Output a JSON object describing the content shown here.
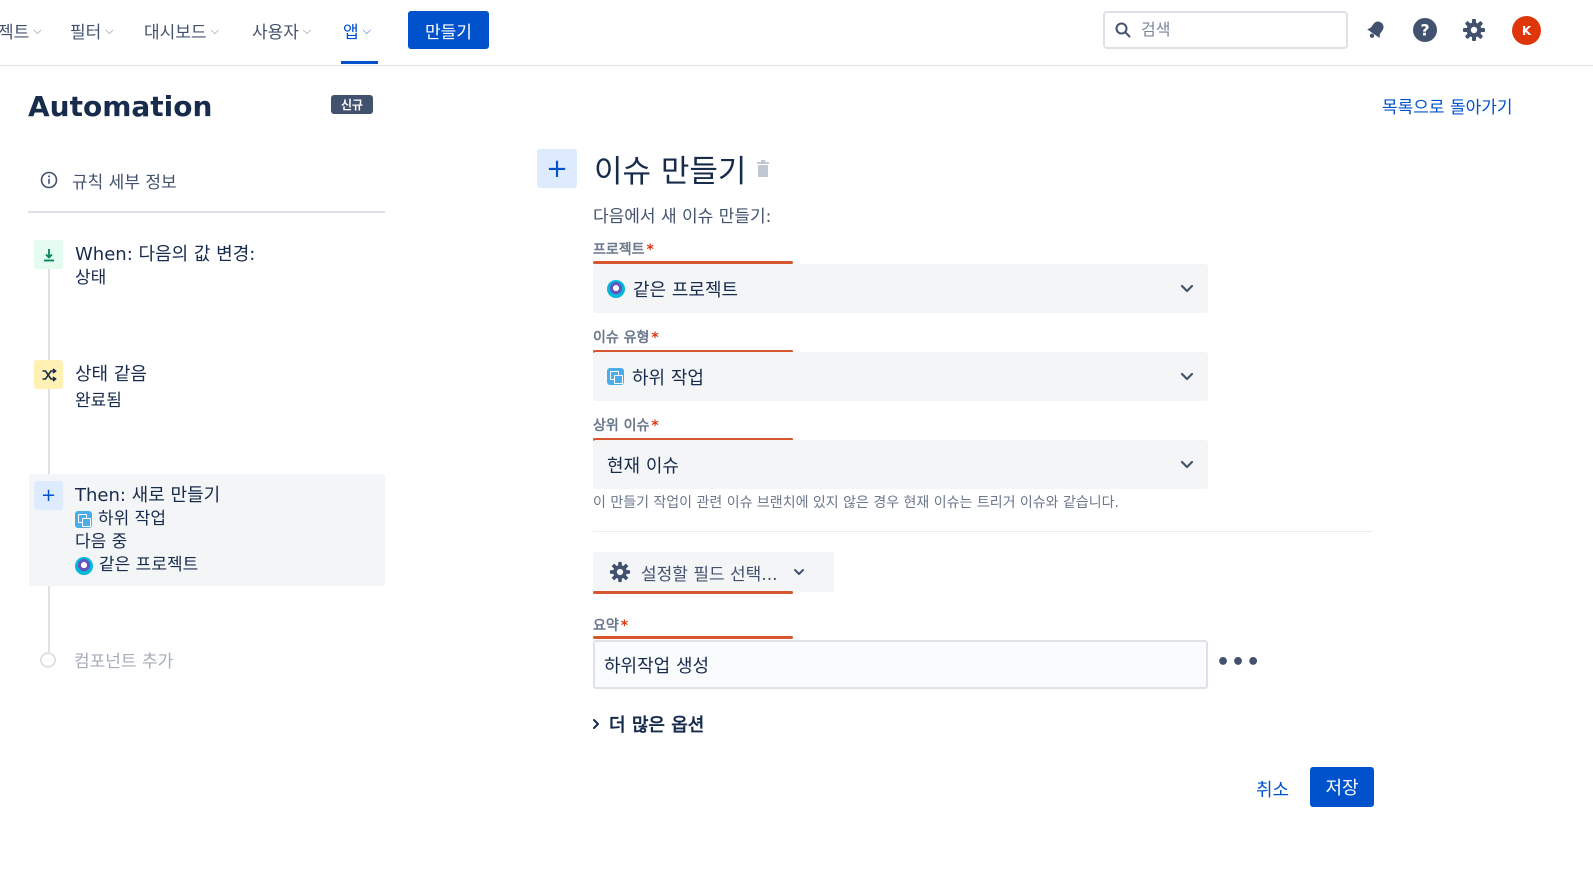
{
  "nav": {
    "items": [
      {
        "label": "젝트"
      },
      {
        "label": "필터"
      },
      {
        "label": "대시보드"
      },
      {
        "label": "사용자"
      },
      {
        "label": "앱"
      }
    ],
    "create_label": "만들기",
    "search_placeholder": "검색",
    "avatar_initial": "K"
  },
  "sidebar": {
    "title": "Automation",
    "badge": "신규",
    "rule_details_label": "규칙 세부 정보",
    "steps": [
      {
        "title": "When: 다음의 값 변경:",
        "sub": "상태"
      },
      {
        "title": "상태 같음",
        "sub": "완료됨"
      },
      {
        "title": "Then: 새로 만들기",
        "line1": "하위 작업",
        "line2": "다음 중",
        "line3": "같은 프로젝트"
      }
    ],
    "add_component_label": "컴포넌트 추가"
  },
  "main": {
    "back_link": "목록으로 돌아가기",
    "title": "이슈 만들기",
    "subtitle": "다음에서 새 이슈 만들기:",
    "fields": {
      "project": {
        "label": "프로젝트",
        "value": "같은 프로젝트"
      },
      "issue_type": {
        "label": "이슈 유형",
        "value": "하위 작업"
      },
      "parent_issue": {
        "label": "상위 이슈",
        "value": "현재 이슈"
      },
      "summary": {
        "label": "요약",
        "value": "하위작업 생성"
      }
    },
    "required_mark": "*",
    "hint": "이 만들기 작업이 관련 이슈 브랜치에 있지 않은 경우 현재 이슈는 트리거 이슈와 같습니다.",
    "choose_fields_label": "설정할 필드 선택...",
    "more_options_label": "더 많은 옵션",
    "cancel_label": "취소",
    "save_label": "저장"
  },
  "colors": {
    "accent": "#0052cc",
    "required": "#de350b",
    "highlight_line": "#d6572f",
    "avatar": "#de350b"
  }
}
